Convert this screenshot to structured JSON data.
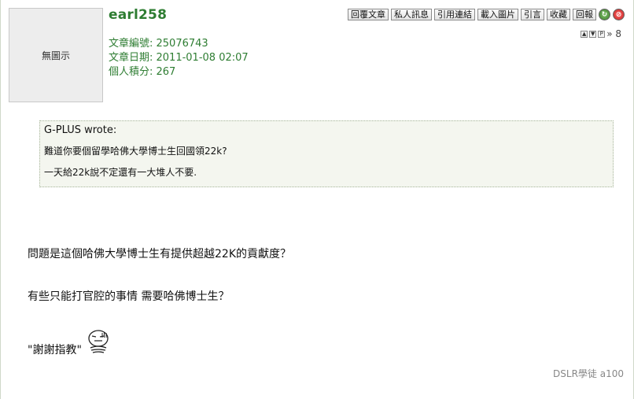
{
  "author": {
    "avatar_text": "無圖示",
    "username": "earl258",
    "post_id": "文章編號: 25076743",
    "post_date": "文章日期: 2011-01-08 02:07",
    "points": "個人積分: 267"
  },
  "toolbar": {
    "buttons": [
      "回覆文章",
      "私人訊息",
      "引用連結",
      "載入圖片",
      "引言",
      "收藏",
      "回報"
    ]
  },
  "floor": {
    "label": "» 8"
  },
  "quote": {
    "header": "G-PLUS wrote:",
    "lines": [
      "難道你要個留學哈佛大學博士生回國領22k?",
      "一天給22k說不定還有一大堆人不要."
    ]
  },
  "body": {
    "lines": [
      "問題是這個哈佛大學博士生有提供超越22K的貢獻度？",
      "有些只能打官腔的事情 需要哈佛博士生？",
      "\"謝謝指教\""
    ]
  },
  "signature": "DSLR學徒 a100",
  "colors": {
    "username": "#2e7d32",
    "quote_bg": "#f4f6ef"
  }
}
